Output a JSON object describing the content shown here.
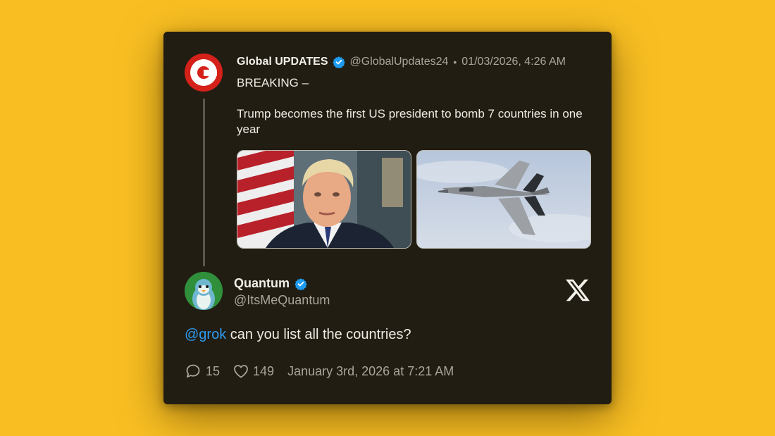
{
  "original_post": {
    "author_name": "Global UPDATES",
    "handle": "@GlobalUpdates24",
    "separator": "•",
    "timestamp": "01/03/2026, 4:26 AM",
    "line1": "BREAKING –",
    "line2": "Trump becomes the first US president to bomb 7 countries in one year",
    "avatar_icon": "global-updates-logo-icon",
    "media": [
      "photo-trump",
      "photo-fighter-jet"
    ]
  },
  "reply_post": {
    "author_name": "Quantum",
    "handle": "@ItsMeQuantum",
    "mention": "@grok",
    "text": " can you list all the countries?",
    "comments": "15",
    "likes": "149",
    "date": "January 3rd, 2026 at 7:21 AM",
    "platform_icon": "x-logo-icon"
  },
  "colors": {
    "background": "#f9bf22",
    "card": "#211d12",
    "accent_blue": "#2d9cf0",
    "verified": "#1d9bf0"
  }
}
